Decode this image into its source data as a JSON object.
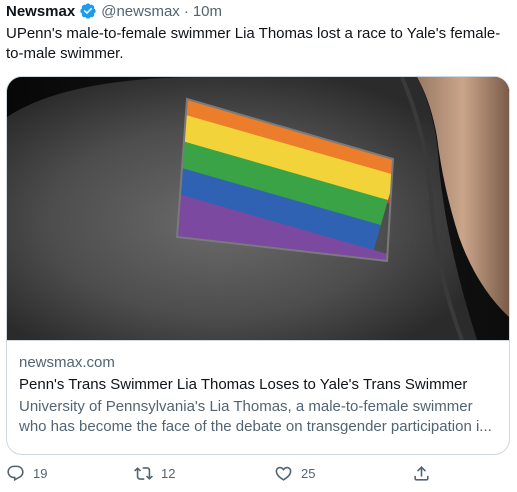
{
  "tweet": {
    "author_name": "Newsmax",
    "handle": "@newsmax",
    "separator": "·",
    "time": "10m",
    "text": "UPenn's male-to-female swimmer Lia Thomas lost a race to Yale's female-to-male swimmer."
  },
  "card": {
    "image_icon": "rainbow-flag-patch-photo",
    "domain": "newsmax.com",
    "title": "Penn's Trans Swimmer Lia Thomas Loses to Yale's Trans Swimmer",
    "description": "University of Pennsylvania's Lia Thomas, a male-to-female swimmer who has become the face of the debate on transgender participation i..."
  },
  "actions": {
    "reply_count": "19",
    "retweet_count": "12",
    "like_count": "25",
    "reply_icon": "reply-icon",
    "retweet_icon": "retweet-icon",
    "like_icon": "heart-icon",
    "share_icon": "share-icon"
  },
  "colors": {
    "verified": "#1d9bf0",
    "secondary_text": "#536471",
    "primary_text": "#0f1419",
    "border": "#cfd9de"
  }
}
